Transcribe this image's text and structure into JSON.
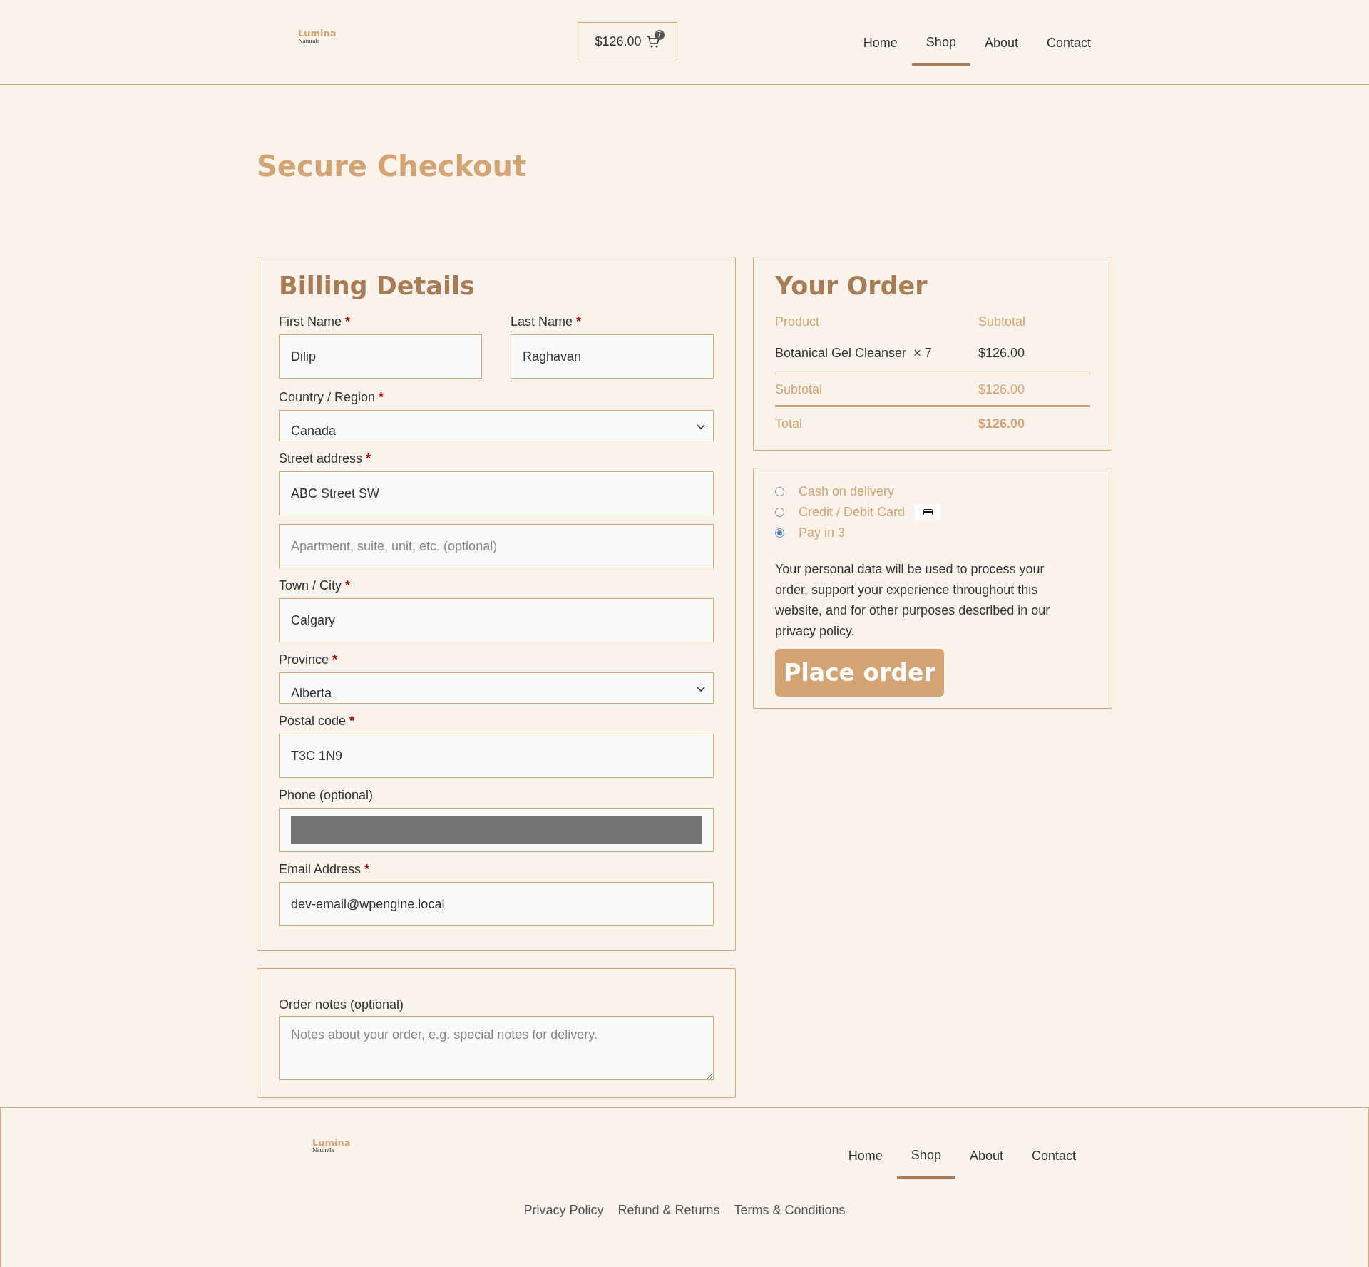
{
  "logo": {
    "name": "Lumina",
    "tagline": "Naturals"
  },
  "cart": {
    "total": "$126.00",
    "count": "7"
  },
  "nav": [
    {
      "label": "Home",
      "selected": false
    },
    {
      "label": "Shop",
      "selected": true
    },
    {
      "label": "About",
      "selected": false
    },
    {
      "label": "Contact",
      "selected": false
    }
  ],
  "page_title": "Secure Checkout",
  "billing": {
    "title": "Billing Details",
    "required_mark": "*",
    "name_fields": [
      {
        "label": "First Name",
        "required": true,
        "kind": "text",
        "value": "Dilip"
      },
      {
        "label": "Last Name",
        "required": true,
        "kind": "text",
        "value": "Raghavan"
      }
    ],
    "fields": [
      {
        "label": "Country / Region",
        "required": true,
        "kind": "select",
        "value": "Canada"
      },
      {
        "label": "Street address",
        "required": true,
        "kind": "text",
        "value": "ABC Street SW"
      },
      {
        "kind": "text",
        "placeholder": "Apartment, suite, unit, etc. (optional)"
      },
      {
        "label": "Town / City",
        "required": true,
        "kind": "text",
        "value": "Calgary"
      },
      {
        "label": "Province",
        "required": true,
        "kind": "select",
        "value": "Alberta"
      },
      {
        "label": "Postal code",
        "required": true,
        "kind": "text",
        "value": "T3C 1N9"
      },
      {
        "label": "Phone (optional)",
        "required": false,
        "kind": "redacted"
      },
      {
        "label": "Email Address",
        "required": true,
        "kind": "text",
        "value": "dev-email@wpengine.local"
      }
    ]
  },
  "notes": {
    "label": "Order notes (optional)",
    "placeholder": "Notes about your order, e.g. special notes for delivery."
  },
  "order": {
    "title": "Your Order",
    "columns": [
      "Product",
      "Subtotal"
    ],
    "items": [
      {
        "product": "Botanical Gel Cleanser",
        "quantity": "× 7",
        "subtotal": "$126.00"
      }
    ],
    "subtotal": {
      "label": "Subtotal",
      "value": "$126.00"
    },
    "total": {
      "label": "Total",
      "value": "$126.00"
    }
  },
  "payment": {
    "methods": [
      {
        "label": "Cash on delivery",
        "selected": false,
        "kind": "plain"
      },
      {
        "label": "Credit / Debit Card",
        "selected": false,
        "kind": "card"
      },
      {
        "label": "Pay in 3",
        "selected": true,
        "kind": "plain"
      }
    ],
    "privacy_text": "Your personal data will be used to process your order, support your experience throughout this website, and for other purposes described in our privacy policy.",
    "button": "Place order"
  },
  "footer": {
    "logo": {
      "name": "Lumina",
      "tagline": "Naturals"
    },
    "nav": [
      {
        "label": "Home",
        "selected": false
      },
      {
        "label": "Shop",
        "selected": true
      },
      {
        "label": "About",
        "selected": false
      },
      {
        "label": "Contact",
        "selected": false
      }
    ],
    "links": [
      "Privacy Policy",
      "Refund & Returns",
      "Terms & Conditions"
    ]
  }
}
